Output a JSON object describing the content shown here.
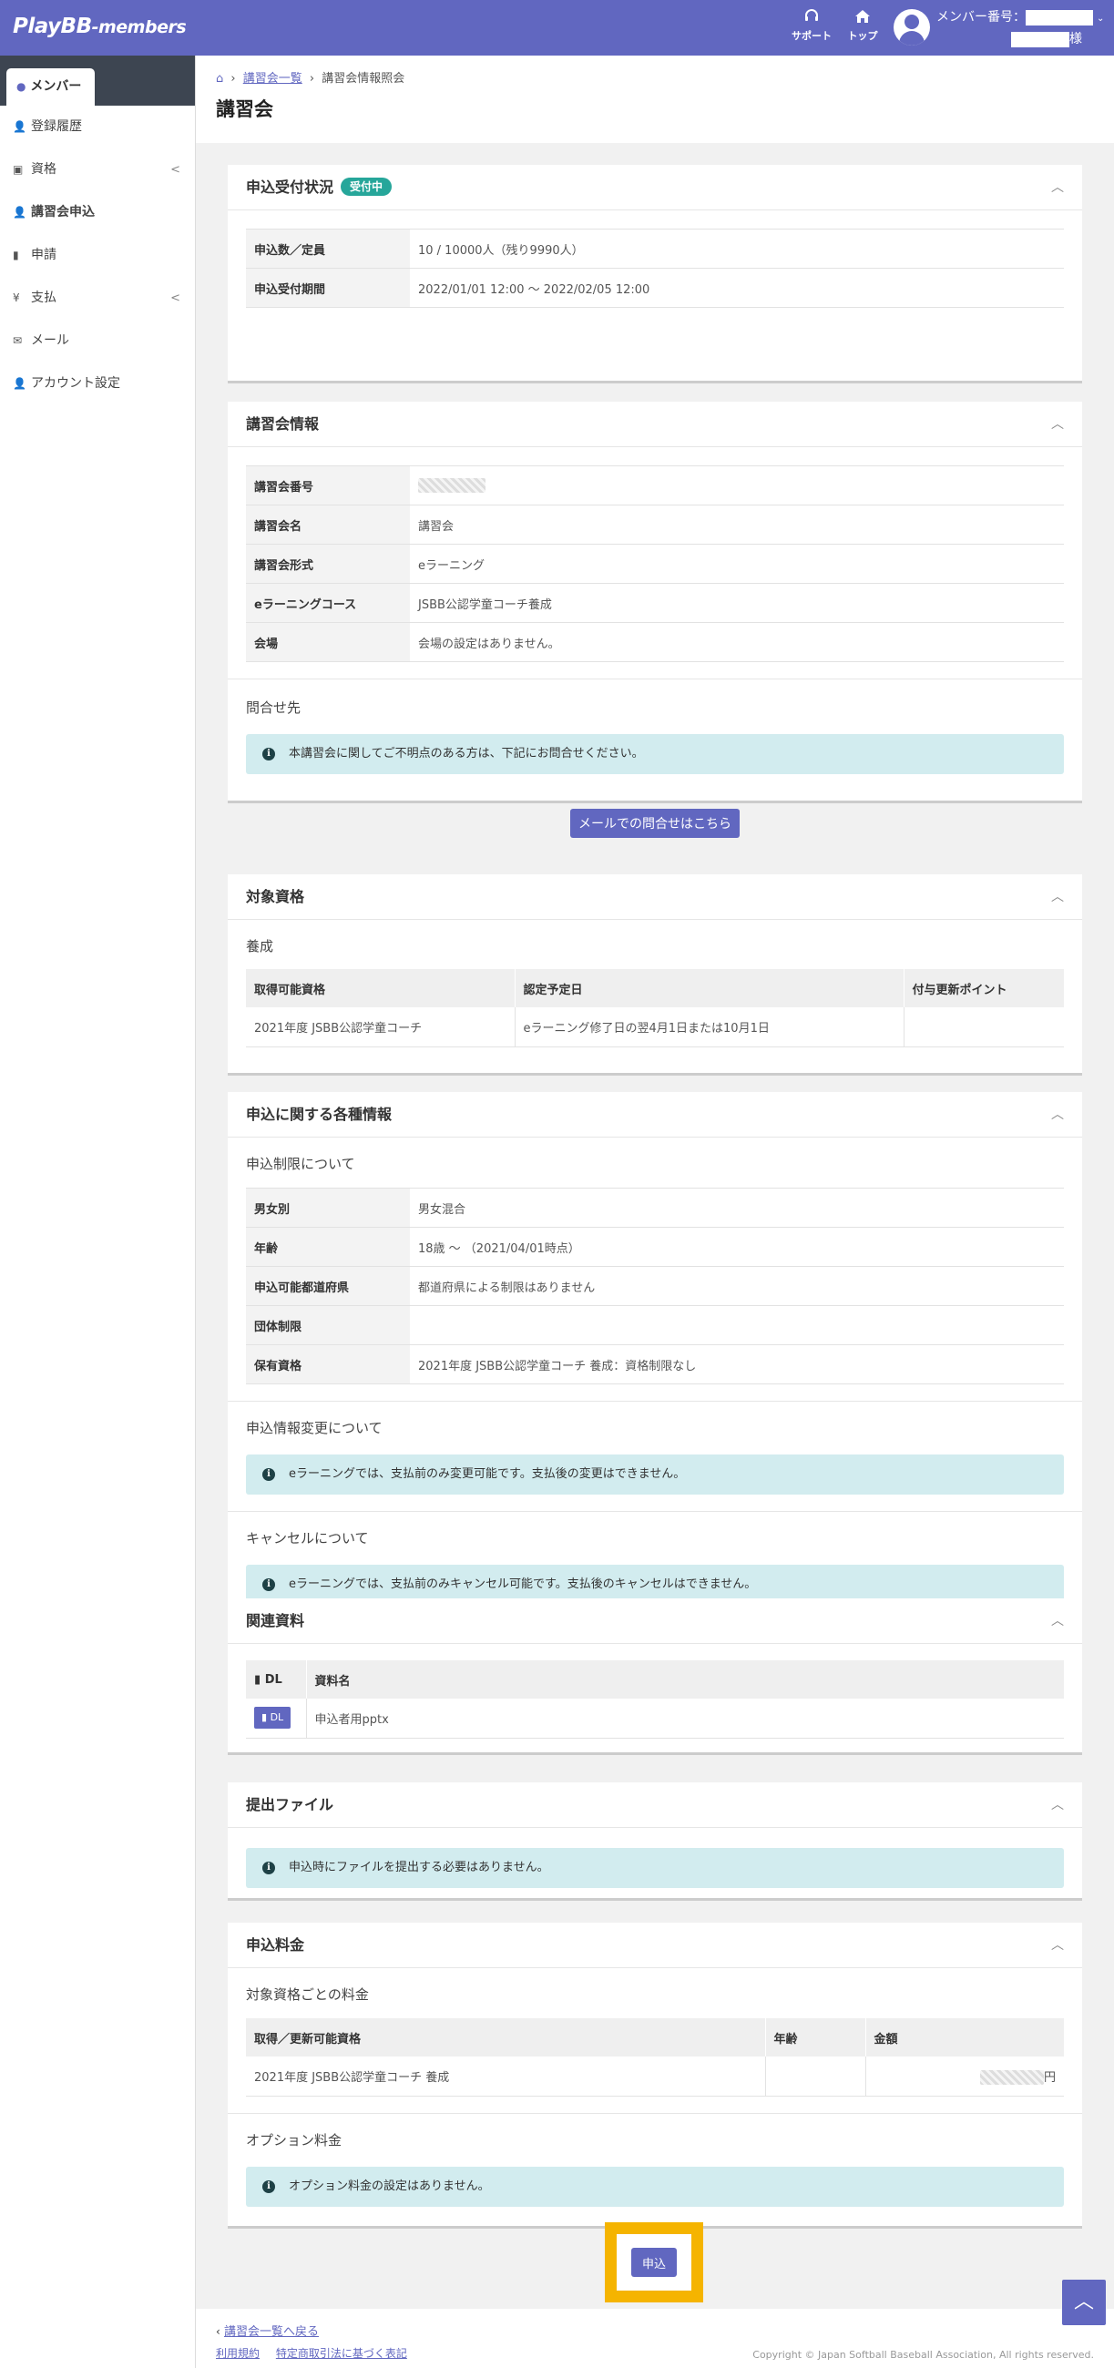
{
  "header": {
    "logo_main": "PlayBB",
    "logo_sub": "-members",
    "support_label": "サポート",
    "support_icon": "headset-icon",
    "top_label": "トップ",
    "top_icon": "home-icon",
    "member_no_label": "メンバー番号：",
    "honorific": "様"
  },
  "sidebar": {
    "active_label": "メンバー",
    "items": [
      {
        "label": "登録履歴",
        "icon": "user-icon"
      },
      {
        "label": "資格",
        "icon": "id-card-icon",
        "chevron": "<"
      },
      {
        "label": "講習会申込",
        "icon": "user-check-icon"
      },
      {
        "label": "申請",
        "icon": "file-icon"
      },
      {
        "label": "支払",
        "icon": "yen-icon",
        "chevron": "<"
      },
      {
        "label": "メール",
        "icon": "envelope-icon"
      },
      {
        "label": "アカウント設定",
        "icon": "user-gear-icon"
      }
    ]
  },
  "page": {
    "breadcrumb_home": "⌂",
    "breadcrumb_list": "講習会一覧",
    "breadcrumb_current": "講習会情報照会",
    "title": "講習会"
  },
  "status": {
    "title": "申込受付状況",
    "badge": "受付中",
    "rows": [
      {
        "k": "申込数／定員",
        "v": "10 / 10000人（残り9990人）"
      },
      {
        "k": "申込受付期間",
        "v": "2022/01/01 12:00 〜 2022/02/05 12:00"
      }
    ]
  },
  "info": {
    "title": "講習会情報",
    "rows": [
      {
        "k": "講習会番号",
        "v": ""
      },
      {
        "k": "講習会名",
        "v": "講習会"
      },
      {
        "k": "講習会形式",
        "v": "eラーニング"
      },
      {
        "k": "eラーニングコース",
        "v": "JSBB公認学童コーチ養成"
      },
      {
        "k": "会場",
        "v": "会場の設定はありません。"
      }
    ],
    "contact_title": "問合せ先",
    "contact_alert": "本講習会に関してご不明点のある方は、下記にお問合せください。",
    "mail_button": "メールでの問合せはこちら"
  },
  "qual": {
    "title": "対象資格",
    "subtitle": "養成",
    "headers": [
      "取得可能資格",
      "認定予定日",
      "付与更新ポイント"
    ],
    "rows": [
      [
        "2021年度 JSBB公認学童コーチ",
        "eラーニング修了日の翌4月1日または10月1日",
        ""
      ]
    ]
  },
  "apply_info": {
    "title": "申込に関する各種情報",
    "limit_title": "申込制限について",
    "rows": [
      {
        "k": "男女別",
        "v": "男女混合"
      },
      {
        "k": "年齢",
        "v": "18歳 〜 （2021/04/01時点）"
      },
      {
        "k": "申込可能都道府県",
        "v": "都道府県による制限はありません"
      },
      {
        "k": "団体制限",
        "v": ""
      },
      {
        "k": "保有資格",
        "v": "2021年度 JSBB公認学童コーチ 養成：資格制限なし"
      }
    ],
    "change_title": "申込情報変更について",
    "change_alert": "eラーニングでは、支払前のみ変更可能です。支払後の変更はできません。",
    "cancel_title": "キャンセルについて",
    "cancel_alert": "eラーニングでは、支払前のみキャンセル可能です。支払後のキャンセルはできません。"
  },
  "docs": {
    "title": "関連資料",
    "h_dl": "DL",
    "h_name": "資料名",
    "dl_label": "DL",
    "file": "申込者用pptx"
  },
  "submit_files": {
    "title": "提出ファイル",
    "alert": "申込時にファイルを提出する必要はありません。"
  },
  "fee": {
    "title": "申込料金",
    "sub1": "対象資格ごとの料金",
    "headers": [
      "取得／更新可能資格",
      "年齢",
      "金額"
    ],
    "row": [
      "2021年度 JSBB公認学童コーチ 養成",
      "",
      "円"
    ],
    "sub2": "オプション料金",
    "alert": "オプション料金の設定はありません。"
  },
  "apply_button": "申込",
  "footer": {
    "back": "講習会一覧へ戻る",
    "terms": "利用規約",
    "law": "特定商取引法に基づく表記",
    "copyright": "Copyright © Japan Softball Baseball Association, All rights reserved."
  },
  "colors": {
    "primary": "#6167c0",
    "badge": "#26a69a",
    "alert_bg": "#d2ecef",
    "highlight": "#f5b400"
  }
}
